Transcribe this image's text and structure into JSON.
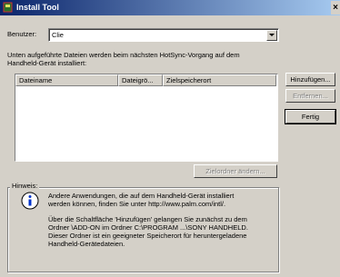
{
  "window": {
    "title": "Install Tool",
    "close": "×"
  },
  "user": {
    "label": "Benutzer:",
    "value": "Clie"
  },
  "instruction": {
    "line1": "Unten aufgeführte Dateien werden beim nächsten HotSync-Vorgang auf dem",
    "line2": "Handheld-Gerät installiert:"
  },
  "list": {
    "columns": [
      "Dateiname",
      "Dateigrö...",
      "Zielspeicherort"
    ]
  },
  "buttons": {
    "add": "Hinzufügen...",
    "remove": "Entfernen...",
    "done": "Fertig",
    "change_target": "Zielordner ändern..."
  },
  "hint": {
    "title": "Hinweis:",
    "p1_l1": "Andere Anwendungen, die auf dem Handheld-Gerät installiert",
    "p1_l2": "werden können, finden Sie unter http://www.palm.com/intl/.",
    "p2_l1": "Über die Schaltfläche 'Hinzufügen' gelangen Sie zunächst zu dem",
    "p2_l2": "Ordner \\ADD-ON im Ordner C:\\PROGRAM ...\\SONY HANDHELD.",
    "p2_l3": "Dieser Ordner ist ein geeigneter Speicherort für heruntergeladene",
    "p2_l4": "Handheld-Gerätedateien."
  }
}
